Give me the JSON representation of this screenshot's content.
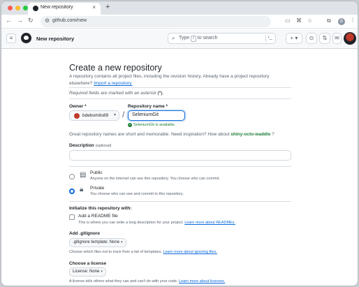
{
  "browser": {
    "tab_title": "New repository",
    "tab_close": "×",
    "new_tab": "+",
    "url": "github.com/new",
    "profile_initial": "B"
  },
  "gh_header": {
    "title": "New repository",
    "search_placeholder_pre": "Type",
    "search_key": "/",
    "search_placeholder_post": "to search",
    "plus_label": "+ ▾"
  },
  "form": {
    "heading": "Create a new repository",
    "lead": "A repository contains all project files, including the revision history. Already have a project repository elsewhere?",
    "import_link": "Import a repository.",
    "required_note_pre": "Required fields are marked with an asterisk",
    "required_note_mark": "(*).",
    "owner_label": "Owner *",
    "owner_value": "bdebomits89",
    "slash": "/",
    "repo_label": "Repository name *",
    "repo_value": "SeleniumGit",
    "available": "SeleniumGit is available.",
    "great_pre": "Great repository names are short and memorable. Need inspiration? How about",
    "suggestion": "shiny-octo-waddle",
    "great_post": "?",
    "desc_label": "Description",
    "desc_optional": "(optional)",
    "visibility": [
      {
        "title": "Public",
        "desc": "Anyone on the internet can see this repository. You choose who can commit.",
        "selected": false
      },
      {
        "title": "Private",
        "desc": "You choose who can see and commit to this repository.",
        "selected": true
      }
    ],
    "init_heading": "Initialize this repository with:",
    "readme_label": "Add a README file",
    "readme_desc_pre": "This is where you can write a long description for your project.",
    "readme_link": "Learn more about READMEs.",
    "gitignore_heading": "Add .gitignore",
    "gitignore_select": ".gitignore template: None",
    "gitignore_desc_pre": "Choose which files not to track from a list of templates.",
    "gitignore_link": "Learn more about ignoring files.",
    "license_heading": "Choose a license",
    "license_select": "License: None",
    "license_desc_pre": "A license tells others what they can and can't do with your code.",
    "license_link": "Learn more about licenses."
  }
}
